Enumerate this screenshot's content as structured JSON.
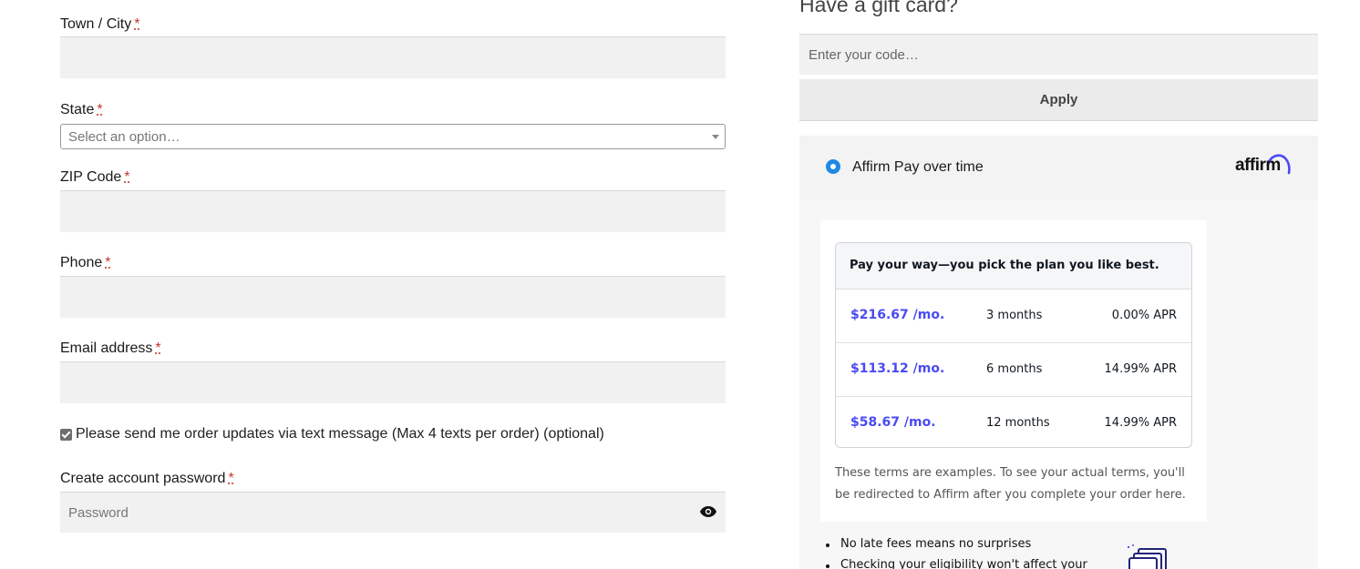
{
  "billing": {
    "city": {
      "label": "Town / City",
      "required_mark": "*"
    },
    "state": {
      "label": "State",
      "required_mark": "*",
      "placeholder": "Select an option…"
    },
    "zip": {
      "label": "ZIP Code",
      "required_mark": "*"
    },
    "phone": {
      "label": "Phone",
      "required_mark": "*"
    },
    "email": {
      "label": "Email address",
      "required_mark": "*"
    },
    "sms_opt_in": {
      "label": "Please send me order updates via text message (Max 4 texts per order) (optional)",
      "checked": true
    },
    "password": {
      "label": "Create account password",
      "required_mark": "*",
      "placeholder": "Password",
      "icon": "eye-icon"
    }
  },
  "gift_card": {
    "title": "Have a gift card?",
    "placeholder": "Enter your code…",
    "apply_label": "Apply"
  },
  "payment": {
    "method_label": "Affirm Pay over time",
    "logo_text": "affirm",
    "selected": true,
    "accent_color": "#1e88e5",
    "plan_header": "Pay your way—you pick the plan you like best.",
    "plans": [
      {
        "amount": "$216.67 /mo.",
        "term": "3 months",
        "apr": "0.00% APR"
      },
      {
        "amount": "$113.12 /mo.",
        "term": "6 months",
        "apr": "14.99% APR"
      },
      {
        "amount": "$58.67 /mo.",
        "term": "12 months",
        "apr": "14.99% APR"
      }
    ],
    "plan_amount_color": "#4a4af4",
    "terms_note": "These terms are examples. To see your actual terms, you'll be redirected to Affirm after you complete your order here.",
    "benefits": [
      "No late fees means no surprises",
      "Checking your eligibility won't affect your"
    ]
  }
}
